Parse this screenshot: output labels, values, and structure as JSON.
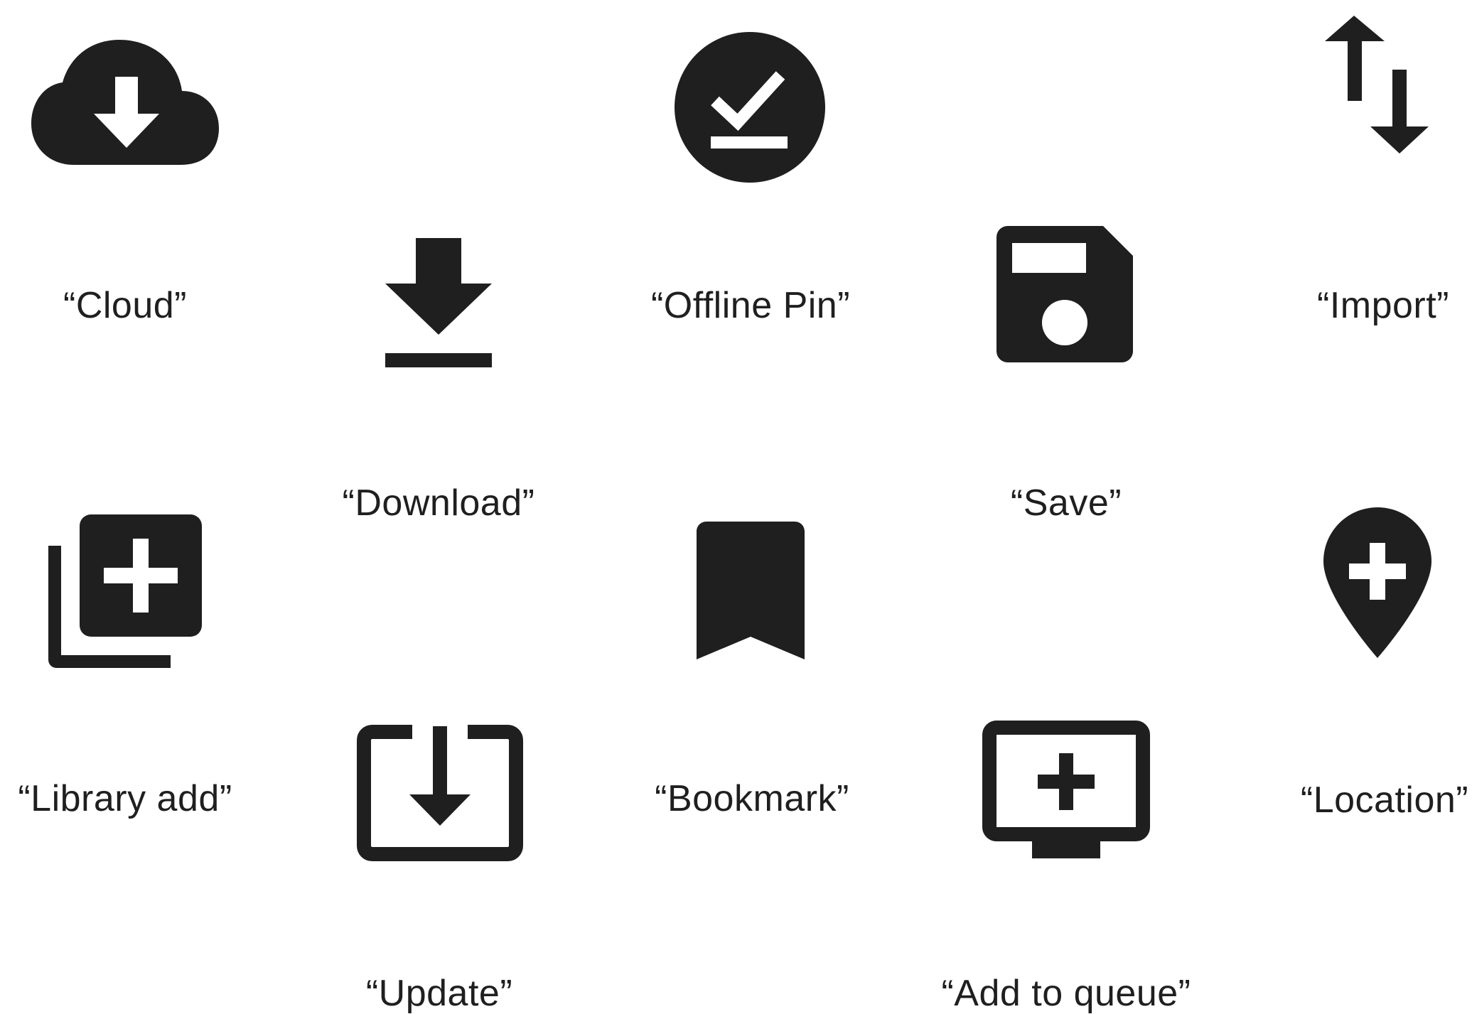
{
  "labels": {
    "cloud": "“Cloud”",
    "offline_pin": "“Offline Pin”",
    "import": "“Import”",
    "download": "“Download”",
    "save": "“Save”",
    "library_add": "“Library add”",
    "bookmark": "“Bookmark”",
    "location": "“Location”",
    "update": "“Update”",
    "add_to_queue": "“Add to queue”"
  },
  "colors": {
    "icon": "#1f1f1f",
    "text": "#1f1f1f",
    "background": "#ffffff"
  }
}
